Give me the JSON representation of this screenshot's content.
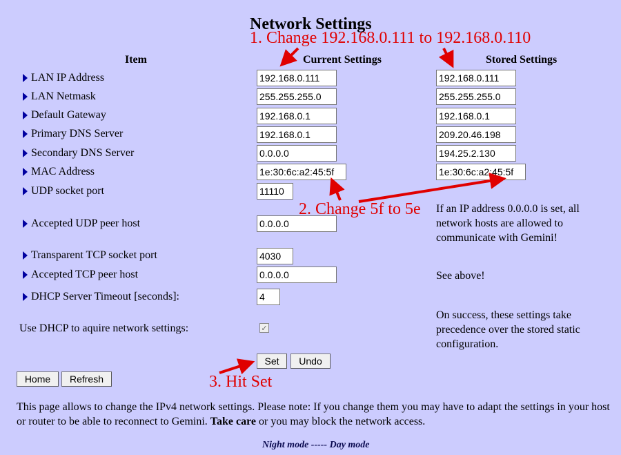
{
  "title": "Network Settings",
  "headers": {
    "item": "Item",
    "current": "Current Settings",
    "stored": "Stored Settings"
  },
  "rows": [
    {
      "label": "LAN IP Address",
      "current": "192.168.0.111",
      "stored": "192.168.0.111"
    },
    {
      "label": "LAN Netmask",
      "current": "255.255.255.0",
      "stored": "255.255.255.0"
    },
    {
      "label": "Default Gateway",
      "current": "192.168.0.1",
      "stored": "192.168.0.1"
    },
    {
      "label": "Primary DNS Server",
      "current": "192.168.0.1",
      "stored": "209.20.46.198"
    },
    {
      "label": "Secondary DNS Server",
      "current": "0.0.0.0",
      "stored": "194.25.2.130"
    },
    {
      "label": "MAC Address",
      "current": "1e:30:6c:a2:45:5f",
      "stored": "1e:30:6c:a2:45:5f"
    },
    {
      "label": "UDP socket port",
      "current": "11110"
    },
    {
      "label": "Accepted UDP peer host",
      "current": "0.0.0.0"
    },
    {
      "label": "Transparent TCP socket port",
      "current": "4030"
    },
    {
      "label": "Accepted TCP peer host",
      "current": "0.0.0.0"
    },
    {
      "label": "DHCP Server Timeout [seconds]:",
      "current": "4"
    }
  ],
  "dhcp": {
    "label": "Use DHCP to aquire network settings:",
    "checked": true
  },
  "notes": {
    "udp_peer": "If an IP address 0.0.0.0 is set, all network hosts are allowed to communicate with Gemini!",
    "tcp_peer": "See above!",
    "dhcp": "On success, these settings take precedence over the stored static configuration."
  },
  "buttons": {
    "set": "Set",
    "undo": "Undo",
    "home": "Home",
    "refresh": "Refresh"
  },
  "annotations": {
    "step1": "1. Change 192.168.0.111 to 192.168.0.110",
    "step2": "2. Change 5f to 5e",
    "step3": "3. Hit Set",
    "color": "#e00000"
  },
  "footer": {
    "text_before": "This page allows to change the IPv4 network settings. Please note: If you change them you may have to adapt the settings in your host or router to be able to reconnect to Gemini. ",
    "bold": "Take care",
    "text_after": " or you may block the network access."
  },
  "modes": {
    "night": "Night mode",
    "separator": " ----- ",
    "day": "Day mode"
  }
}
